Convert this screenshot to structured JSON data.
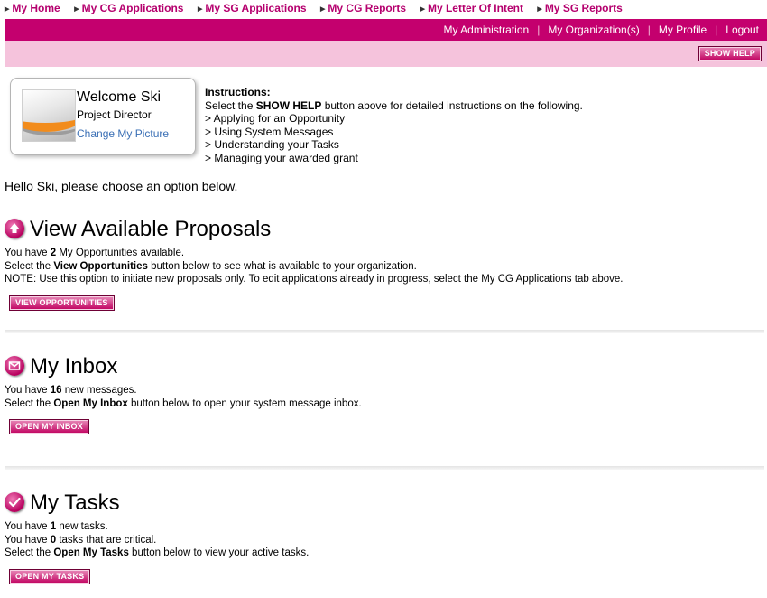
{
  "nav": {
    "tabs": [
      "My Home",
      "My CG Applications",
      "My SG Applications",
      "My CG Reports",
      "My Letter Of Intent",
      "My SG Reports"
    ]
  },
  "adminbar": {
    "links": [
      "My Administration",
      "My Organization(s)",
      "My Profile",
      "Logout"
    ],
    "separator": "|"
  },
  "helpbar": {
    "show_help": "SHOW HELP"
  },
  "welcome": {
    "title": "Welcome Ski",
    "role": "Project Director",
    "change_picture": "Change My Picture"
  },
  "instructions": {
    "title": "Instructions:",
    "line_pre": "Select the ",
    "line_bold": "SHOW HELP",
    "line_post": " button above for detailed instructions on the following.",
    "items": [
      "> Applying for an Opportunity",
      "> Using System Messages",
      "> Understanding your Tasks",
      "> Managing your awarded grant"
    ]
  },
  "hello": "Hello Ski, please choose an option below.",
  "proposals": {
    "title": "View Available Proposals",
    "l1_pre": "You have ",
    "count": "2",
    "l1_post": " My Opportunities available.",
    "l2_pre": "Select the ",
    "l2_bold": "View Opportunities",
    "l2_post": " button below to see what is available to your organization.",
    "note": "NOTE: Use this option to initiate new proposals only. To edit applications already in progress, select the My CG Applications tab above.",
    "button": "VIEW OPPORTUNITIES"
  },
  "inbox": {
    "title": "My Inbox",
    "l1_pre": "You have ",
    "count": "16",
    "l1_post": " new messages.",
    "l2_pre": "Select the ",
    "l2_bold": "Open My Inbox",
    "l2_post": " button below to open your system message inbox.",
    "button": "OPEN MY INBOX"
  },
  "tasks": {
    "title": "My Tasks",
    "l1_pre": "You have ",
    "count": "1",
    "l1_post": " new tasks.",
    "l2_pre": "You have ",
    "critical": "0",
    "l2_post": " tasks that are critical.",
    "l3_pre": "Select the ",
    "l3_bold": "Open My Tasks",
    "l3_post": " button below to view your active tasks.",
    "button": "OPEN MY TASKS"
  },
  "colors": {
    "brand": "#c4006e",
    "help_bar": "#f5c3dc",
    "link": "#3a6fb5"
  },
  "icons": [
    "arrow-right-icon",
    "upload-arrow-icon",
    "envelope-icon",
    "checkmark-icon",
    "default-avatar-image"
  ]
}
